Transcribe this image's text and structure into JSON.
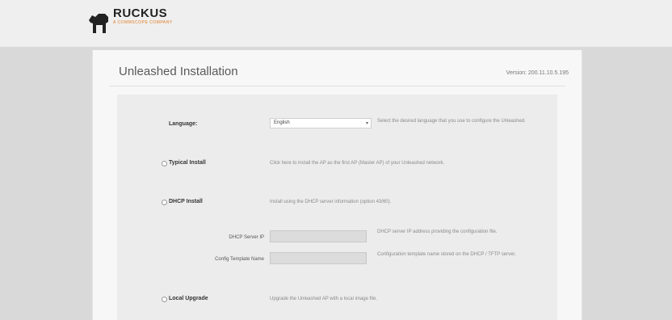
{
  "brand": {
    "name": "RUCKUS",
    "tagline": "A COMMSCOPE COMPANY"
  },
  "page": {
    "title": "Unleashed Installation",
    "version": "Version: 200.11.10.5.195"
  },
  "form": {
    "language": {
      "label": "Language:",
      "value": "English",
      "description": "Select the desired language that you use to configure the Unleashed."
    },
    "options": [
      {
        "label": "Typical Install",
        "description": "Click here to install the AP as the first AP (Master AP) of your Unleashed network."
      },
      {
        "label": "DHCP Install",
        "description": "Install using the DHCP server information (option 43/60)."
      },
      {
        "label": "Local Upgrade",
        "description": "Upgrade the Unleashed AP with a local image file."
      }
    ],
    "fields": [
      {
        "label": "DHCP Server IP",
        "description": "DHCP server IP address providing the configuration file."
      },
      {
        "label": "Config Template Name",
        "description": "Configuration template name stored on the DHCP / TFTP server."
      }
    ]
  }
}
